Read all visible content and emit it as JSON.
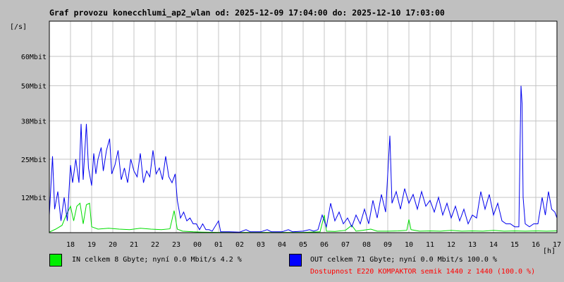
{
  "chart_data": {
    "type": "line",
    "title": "Graf provozu konecchlumi_ap2_wlan od: 2025-12-09 17:04:00 do: 2025-12-10 17:03:00",
    "ylabel": "[/s]",
    "xlabel": "[h]",
    "ylim": [
      0,
      72
    ],
    "yticks": [
      12,
      25,
      38,
      50,
      60
    ],
    "ytick_labels": [
      "12Mbit",
      "25Mbit",
      "38Mbit",
      "50Mbit",
      "60Mbit"
    ],
    "xticks": [
      1,
      2,
      3,
      4,
      5,
      6,
      7,
      8,
      9,
      10,
      11,
      12,
      13,
      14,
      15,
      16,
      17,
      18,
      19,
      20,
      21,
      22,
      23,
      24
    ],
    "xtick_labels": [
      "18",
      "19",
      "20",
      "21",
      "22",
      "23",
      "00",
      "01",
      "02",
      "03",
      "04",
      "05",
      "06",
      "07",
      "08",
      "09",
      "10",
      "11",
      "12",
      "13",
      "14",
      "15",
      "16",
      "17"
    ],
    "xlim": [
      0,
      24
    ],
    "grid": true,
    "series": [
      {
        "name": "IN",
        "color": "#00dd00",
        "points": [
          [
            0.0,
            0.2
          ],
          [
            0.3,
            1.2
          ],
          [
            0.6,
            2.5
          ],
          [
            0.8,
            6
          ],
          [
            1.0,
            9
          ],
          [
            1.15,
            4
          ],
          [
            1.3,
            9
          ],
          [
            1.45,
            10
          ],
          [
            1.6,
            3
          ],
          [
            1.75,
            9.5
          ],
          [
            1.9,
            10
          ],
          [
            2.0,
            2
          ],
          [
            2.3,
            1.2
          ],
          [
            2.8,
            1.5
          ],
          [
            3.3,
            1.2
          ],
          [
            3.8,
            1
          ],
          [
            4.3,
            1.5
          ],
          [
            4.8,
            1.2
          ],
          [
            5.3,
            1
          ],
          [
            5.7,
            1.3
          ],
          [
            5.9,
            7.5
          ],
          [
            6.05,
            1.2
          ],
          [
            6.3,
            0.5
          ],
          [
            6.8,
            0.3
          ],
          [
            7.2,
            0.2
          ],
          [
            8,
            0.1
          ],
          [
            9,
            0.1
          ],
          [
            10,
            0.1
          ],
          [
            11,
            0.1
          ],
          [
            12,
            0.1
          ],
          [
            12.8,
            0.3
          ],
          [
            13.0,
            6
          ],
          [
            13.1,
            0.5
          ],
          [
            13.5,
            0.4
          ],
          [
            14.0,
            0.8
          ],
          [
            14.3,
            2.5
          ],
          [
            14.5,
            0.5
          ],
          [
            14.8,
            0.8
          ],
          [
            15.2,
            1.2
          ],
          [
            15.5,
            0.5
          ],
          [
            16,
            0.5
          ],
          [
            16.5,
            0.6
          ],
          [
            16.9,
            0.8
          ],
          [
            17.0,
            4.5
          ],
          [
            17.1,
            1
          ],
          [
            17.5,
            0.5
          ],
          [
            18,
            0.6
          ],
          [
            18.5,
            0.5
          ],
          [
            19,
            0.8
          ],
          [
            19.5,
            0.5
          ],
          [
            20,
            0.6
          ],
          [
            20.5,
            0.5
          ],
          [
            21,
            0.8
          ],
          [
            21.5,
            0.5
          ],
          [
            22,
            0.6
          ],
          [
            22.5,
            0.5
          ],
          [
            23,
            0.6
          ],
          [
            23.5,
            0.5
          ],
          [
            24,
            0.6
          ]
        ]
      },
      {
        "name": "OUT",
        "color": "#0000ee",
        "points": [
          [
            0.0,
            6
          ],
          [
            0.15,
            26
          ],
          [
            0.25,
            8
          ],
          [
            0.4,
            14
          ],
          [
            0.55,
            4
          ],
          [
            0.7,
            12
          ],
          [
            0.85,
            4
          ],
          [
            1.0,
            23
          ],
          [
            1.1,
            17
          ],
          [
            1.25,
            25
          ],
          [
            1.4,
            17
          ],
          [
            1.5,
            37
          ],
          [
            1.6,
            18
          ],
          [
            1.75,
            37
          ],
          [
            1.85,
            22
          ],
          [
            2.0,
            16
          ],
          [
            2.1,
            27
          ],
          [
            2.2,
            20
          ],
          [
            2.3,
            25
          ],
          [
            2.45,
            29
          ],
          [
            2.55,
            21
          ],
          [
            2.7,
            28
          ],
          [
            2.85,
            32
          ],
          [
            2.95,
            20
          ],
          [
            3.1,
            23
          ],
          [
            3.25,
            28
          ],
          [
            3.4,
            18
          ],
          [
            3.55,
            22
          ],
          [
            3.7,
            17
          ],
          [
            3.85,
            25
          ],
          [
            4.0,
            21
          ],
          [
            4.15,
            19
          ],
          [
            4.3,
            27
          ],
          [
            4.45,
            17
          ],
          [
            4.6,
            21
          ],
          [
            4.75,
            19
          ],
          [
            4.9,
            28
          ],
          [
            5.05,
            20
          ],
          [
            5.2,
            22
          ],
          [
            5.35,
            18
          ],
          [
            5.5,
            26
          ],
          [
            5.65,
            19
          ],
          [
            5.8,
            17
          ],
          [
            5.95,
            20
          ],
          [
            6.05,
            11
          ],
          [
            6.2,
            5
          ],
          [
            6.35,
            7
          ],
          [
            6.5,
            4
          ],
          [
            6.65,
            5
          ],
          [
            6.8,
            3
          ],
          [
            6.95,
            3
          ],
          [
            7.1,
            1
          ],
          [
            7.25,
            3
          ],
          [
            7.4,
            1
          ],
          [
            7.55,
            1
          ],
          [
            7.7,
            0.5
          ],
          [
            8.0,
            4
          ],
          [
            8.1,
            0.3
          ],
          [
            8.5,
            0.3
          ],
          [
            9,
            0.2
          ],
          [
            9.3,
            1
          ],
          [
            9.5,
            0.3
          ],
          [
            10,
            0.3
          ],
          [
            10.3,
            1
          ],
          [
            10.5,
            0.3
          ],
          [
            11,
            0.3
          ],
          [
            11.3,
            1
          ],
          [
            11.5,
            0.3
          ],
          [
            12,
            0.5
          ],
          [
            12.3,
            1
          ],
          [
            12.5,
            0.5
          ],
          [
            12.7,
            1
          ],
          [
            12.9,
            6
          ],
          [
            13.1,
            2
          ],
          [
            13.3,
            10
          ],
          [
            13.5,
            4
          ],
          [
            13.7,
            7
          ],
          [
            13.9,
            3
          ],
          [
            14.1,
            5
          ],
          [
            14.3,
            2
          ],
          [
            14.5,
            6
          ],
          [
            14.7,
            3
          ],
          [
            14.9,
            8
          ],
          [
            15.1,
            3
          ],
          [
            15.3,
            11
          ],
          [
            15.5,
            5
          ],
          [
            15.7,
            13
          ],
          [
            15.9,
            7
          ],
          [
            16.1,
            33
          ],
          [
            16.2,
            10
          ],
          [
            16.4,
            14
          ],
          [
            16.6,
            8
          ],
          [
            16.8,
            15
          ],
          [
            17.0,
            10
          ],
          [
            17.2,
            13
          ],
          [
            17.4,
            8
          ],
          [
            17.6,
            14
          ],
          [
            17.8,
            9
          ],
          [
            18.0,
            11
          ],
          [
            18.2,
            7
          ],
          [
            18.4,
            12
          ],
          [
            18.6,
            6
          ],
          [
            18.8,
            10
          ],
          [
            19.0,
            5
          ],
          [
            19.2,
            9
          ],
          [
            19.4,
            4
          ],
          [
            19.6,
            8
          ],
          [
            19.8,
            3
          ],
          [
            20.0,
            6
          ],
          [
            20.2,
            5
          ],
          [
            20.4,
            14
          ],
          [
            20.6,
            8
          ],
          [
            20.8,
            13
          ],
          [
            21.0,
            6
          ],
          [
            21.2,
            10
          ],
          [
            21.4,
            4
          ],
          [
            21.6,
            3
          ],
          [
            21.8,
            3
          ],
          [
            22.0,
            2
          ],
          [
            22.2,
            2
          ],
          [
            22.3,
            50
          ],
          [
            22.35,
            44
          ],
          [
            22.4,
            12
          ],
          [
            22.5,
            3
          ],
          [
            22.7,
            2
          ],
          [
            22.9,
            3
          ],
          [
            23.1,
            3
          ],
          [
            23.3,
            12
          ],
          [
            23.45,
            6
          ],
          [
            23.6,
            14
          ],
          [
            23.75,
            8
          ],
          [
            23.9,
            7
          ],
          [
            24.0,
            5
          ]
        ]
      }
    ]
  },
  "legend": {
    "in_text": "IN celkem 8 Gbyte; nyní   0.0 Mbit/s 4.2 %",
    "in_color": "#00ee00",
    "out_text": "OUT celkem 71 Gbyte; nyní   0.0 Mbit/s 100.0 %",
    "out_color": "#0000ff"
  },
  "availability": {
    "text": "Dostupnost E220 KOMPAKTOR semik 1440 z 1440 (100.0 %)",
    "color": "#ff0000"
  }
}
